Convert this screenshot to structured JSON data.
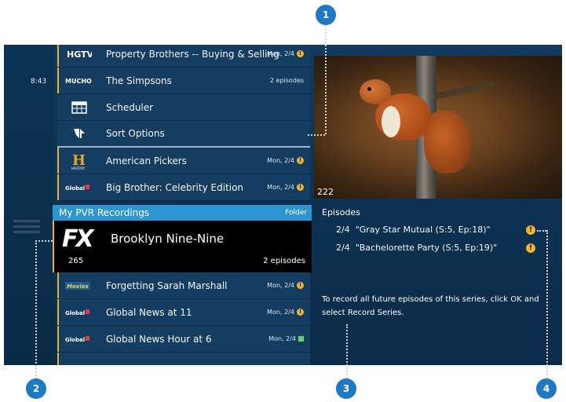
{
  "list": {
    "time": "8:43",
    "rows": [
      {
        "logo": "HGTV",
        "title": "Property Brothers -- Buying & Selling",
        "meta": "Mon, 2/4",
        "status": "warning"
      },
      {
        "logo": "MUCHO",
        "title": "The Simpsons",
        "meta": "2 episodes",
        "status": ""
      },
      {
        "logo": "scheduler-icon",
        "title": "Scheduler",
        "meta": "",
        "status": ""
      },
      {
        "logo": "sort-icon",
        "title": "Sort Options",
        "meta": "",
        "status": ""
      },
      {
        "logo": "HISTORY",
        "title": "American Pickers",
        "meta": "Mon, 2/4",
        "status": "warning"
      },
      {
        "logo": "Global",
        "title": "Big Brother: Celebrity Edition",
        "meta": "Mon, 2/4",
        "status": "warning"
      }
    ],
    "folder": {
      "title": "My PVR Recordings",
      "right": "Folder"
    },
    "selected": {
      "logo": "FX",
      "title": "Brooklyn Nine-Nine",
      "channel": "265",
      "episodes": "2 episodes"
    },
    "rows_below": [
      {
        "logo": "Movies",
        "title": "Forgetting Sarah Marshall",
        "meta": "Mon, 2/4",
        "status": "warning"
      },
      {
        "logo": "Global",
        "title": "Global News at 11",
        "meta": "Mon, 2/4",
        "status": "warning"
      },
      {
        "logo": "Global",
        "title": "Global News Hour at 6",
        "meta": "Mon, 2/4",
        "status": "recorded"
      }
    ]
  },
  "preview": {
    "channel": "222"
  },
  "episodes": {
    "label": "Episodes",
    "items": [
      {
        "date": "2/4",
        "name": "\"Gray Star Mutual (S:5, Ep:18)\""
      },
      {
        "date": "2/4",
        "name": "\"Bachelorette Party (S:5, Ep:19)\""
      }
    ],
    "info": "To record all future episodes of this series, click OK and select Record Series."
  },
  "callouts": [
    "1",
    "2",
    "3",
    "4"
  ],
  "colors": {
    "accent": "#2e95d3",
    "warning": "#f0b429",
    "callout": "#1f78c3"
  }
}
